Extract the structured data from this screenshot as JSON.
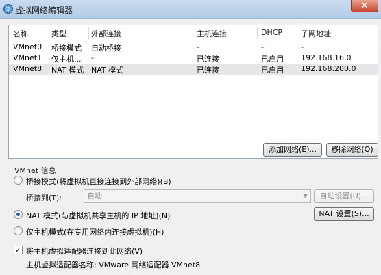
{
  "window": {
    "title": "虚拟网络编辑器",
    "close_glyph": "✕"
  },
  "table": {
    "headers": [
      "名称",
      "类型",
      "外部连接",
      "主机连接",
      "DHCP",
      "子网地址"
    ],
    "rows": [
      [
        "VMnet0",
        "桥接模式",
        "自动桥接",
        "-",
        "-",
        "-"
      ],
      [
        "VMnet1",
        "仅主机...",
        "-",
        "已连接",
        "已启用",
        "192.168.16.0"
      ],
      [
        "VMnet8",
        "NAT 模式",
        "NAT 模式",
        "已连接",
        "已启用",
        "192.168.200.0"
      ]
    ],
    "selected_row": 2
  },
  "buttons": {
    "add_network": "添加网络(E)...",
    "remove_network": "移除网络(O)"
  },
  "vmnet_info": {
    "group_label": "VMnet 信息",
    "bridge_mode_label": "桥接模式(将虚拟机直接连接到外部网络)(B)",
    "bridge_to_label": "桥接到(T):",
    "bridge_to_value": "自动",
    "auto_settings_label": "自动设置(U)...",
    "nat_mode_label": "NAT 模式(与虚拟机共享主机的 IP 地址)(N)",
    "nat_settings_label": "NAT 设置(S)...",
    "host_only_label": "仅主机模式(在专用网络内连接虚拟机)(H)",
    "selected_mode": "nat",
    "connect_adapter_label": "将主机虚拟适配器连接到此网络(V)",
    "connect_adapter_checked": true,
    "adapter_name_label": "主机虚拟适配器名称: VMware 网络适配器 VMnet8"
  },
  "colors": {
    "titlebar": "#b3cbe6",
    "selected_row": "#e6e6e6",
    "radio_dot": "#2a57a6"
  }
}
